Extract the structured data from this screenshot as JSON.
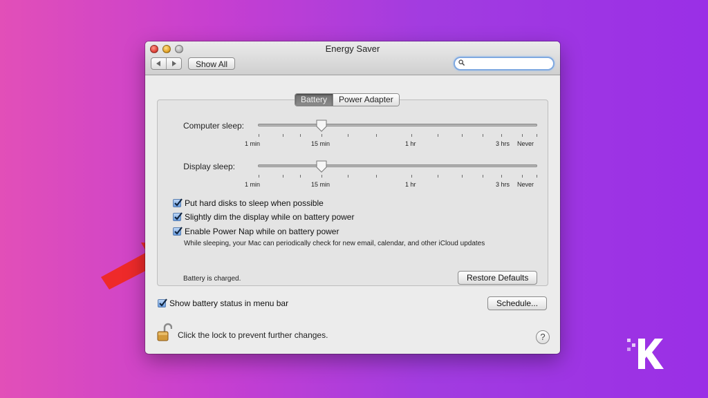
{
  "window": {
    "title": "Energy Saver",
    "show_all_label": "Show All",
    "search_value": ""
  },
  "tabs": [
    {
      "label": "Battery",
      "selected": true
    },
    {
      "label": "Power Adapter",
      "selected": false
    }
  ],
  "sliders": {
    "computer_sleep": {
      "label": "Computer sleep:",
      "value": "15 min"
    },
    "display_sleep": {
      "label": "Display sleep:",
      "value": "15 min"
    },
    "tick_labels": [
      "1 min",
      "15 min",
      "1 hr",
      "3 hrs",
      "Never"
    ]
  },
  "options": [
    {
      "label": "Put hard disks to sleep when possible",
      "checked": true
    },
    {
      "label": "Slightly dim the display while on battery power",
      "checked": true
    },
    {
      "label": "Enable Power Nap while on battery power",
      "checked": true
    }
  ],
  "power_nap_hint": "While sleeping, your Mac can periodically check for new email, calendar, and other iCloud updates",
  "battery_status": "Battery is charged.",
  "restore_defaults_label": "Restore Defaults",
  "show_battery_status": {
    "label": "Show battery status in menu bar",
    "checked": true
  },
  "schedule_label": "Schedule...",
  "lock_text": "Click the lock to prevent further changes.",
  "help_label": "?",
  "colors": {
    "arrow": "#ee2a2a",
    "checkbox_accent": "#4a86d8",
    "background_left": "#e24fb8",
    "background_right": "#9a2fe6"
  },
  "icons": [
    "search-icon",
    "lock-icon",
    "back-arrow-icon",
    "forward-arrow-icon",
    "red-arrow-icon",
    "watermark-logo"
  ]
}
